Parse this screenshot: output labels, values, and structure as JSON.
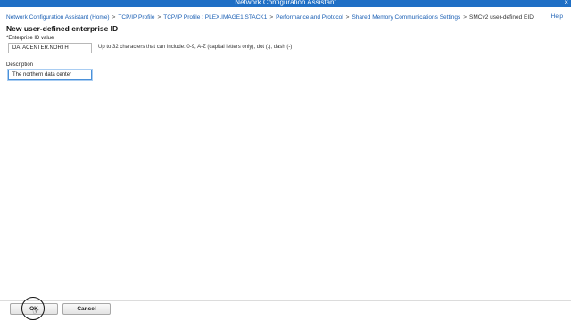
{
  "window": {
    "title": "Network Configuration Assistant",
    "close_symbol": "×"
  },
  "breadcrumb": {
    "items": [
      "Network Configuration Assistant (Home)",
      "TCP/IP Profile",
      "TCP/IP Profile : PLEX.IMAGE1.STACK1",
      "Performance and Protocol",
      "Shared Memory Communications Settings"
    ],
    "separator": ">",
    "current": "SMCv2 user-defined EID"
  },
  "help_link": "Help",
  "page_title": "New user-defined enterprise ID",
  "form": {
    "eid_label": "*Enterprise ID value",
    "eid_value": "DATACENTER.NORTH",
    "eid_hint": "Up to 32 characters that can include: 0-9, A-Z (capital letters only), dot (.), dash (-)",
    "description_label": "Description",
    "description_value": "The northern data center"
  },
  "buttons": {
    "ok": "OK",
    "cancel": "Cancel"
  },
  "icons": {
    "cursor": "hand-pointer-icon",
    "click_ring": "click-indicator-icon"
  },
  "colors": {
    "titlebar": "#1f6fc5",
    "link": "#1a5fb4"
  }
}
